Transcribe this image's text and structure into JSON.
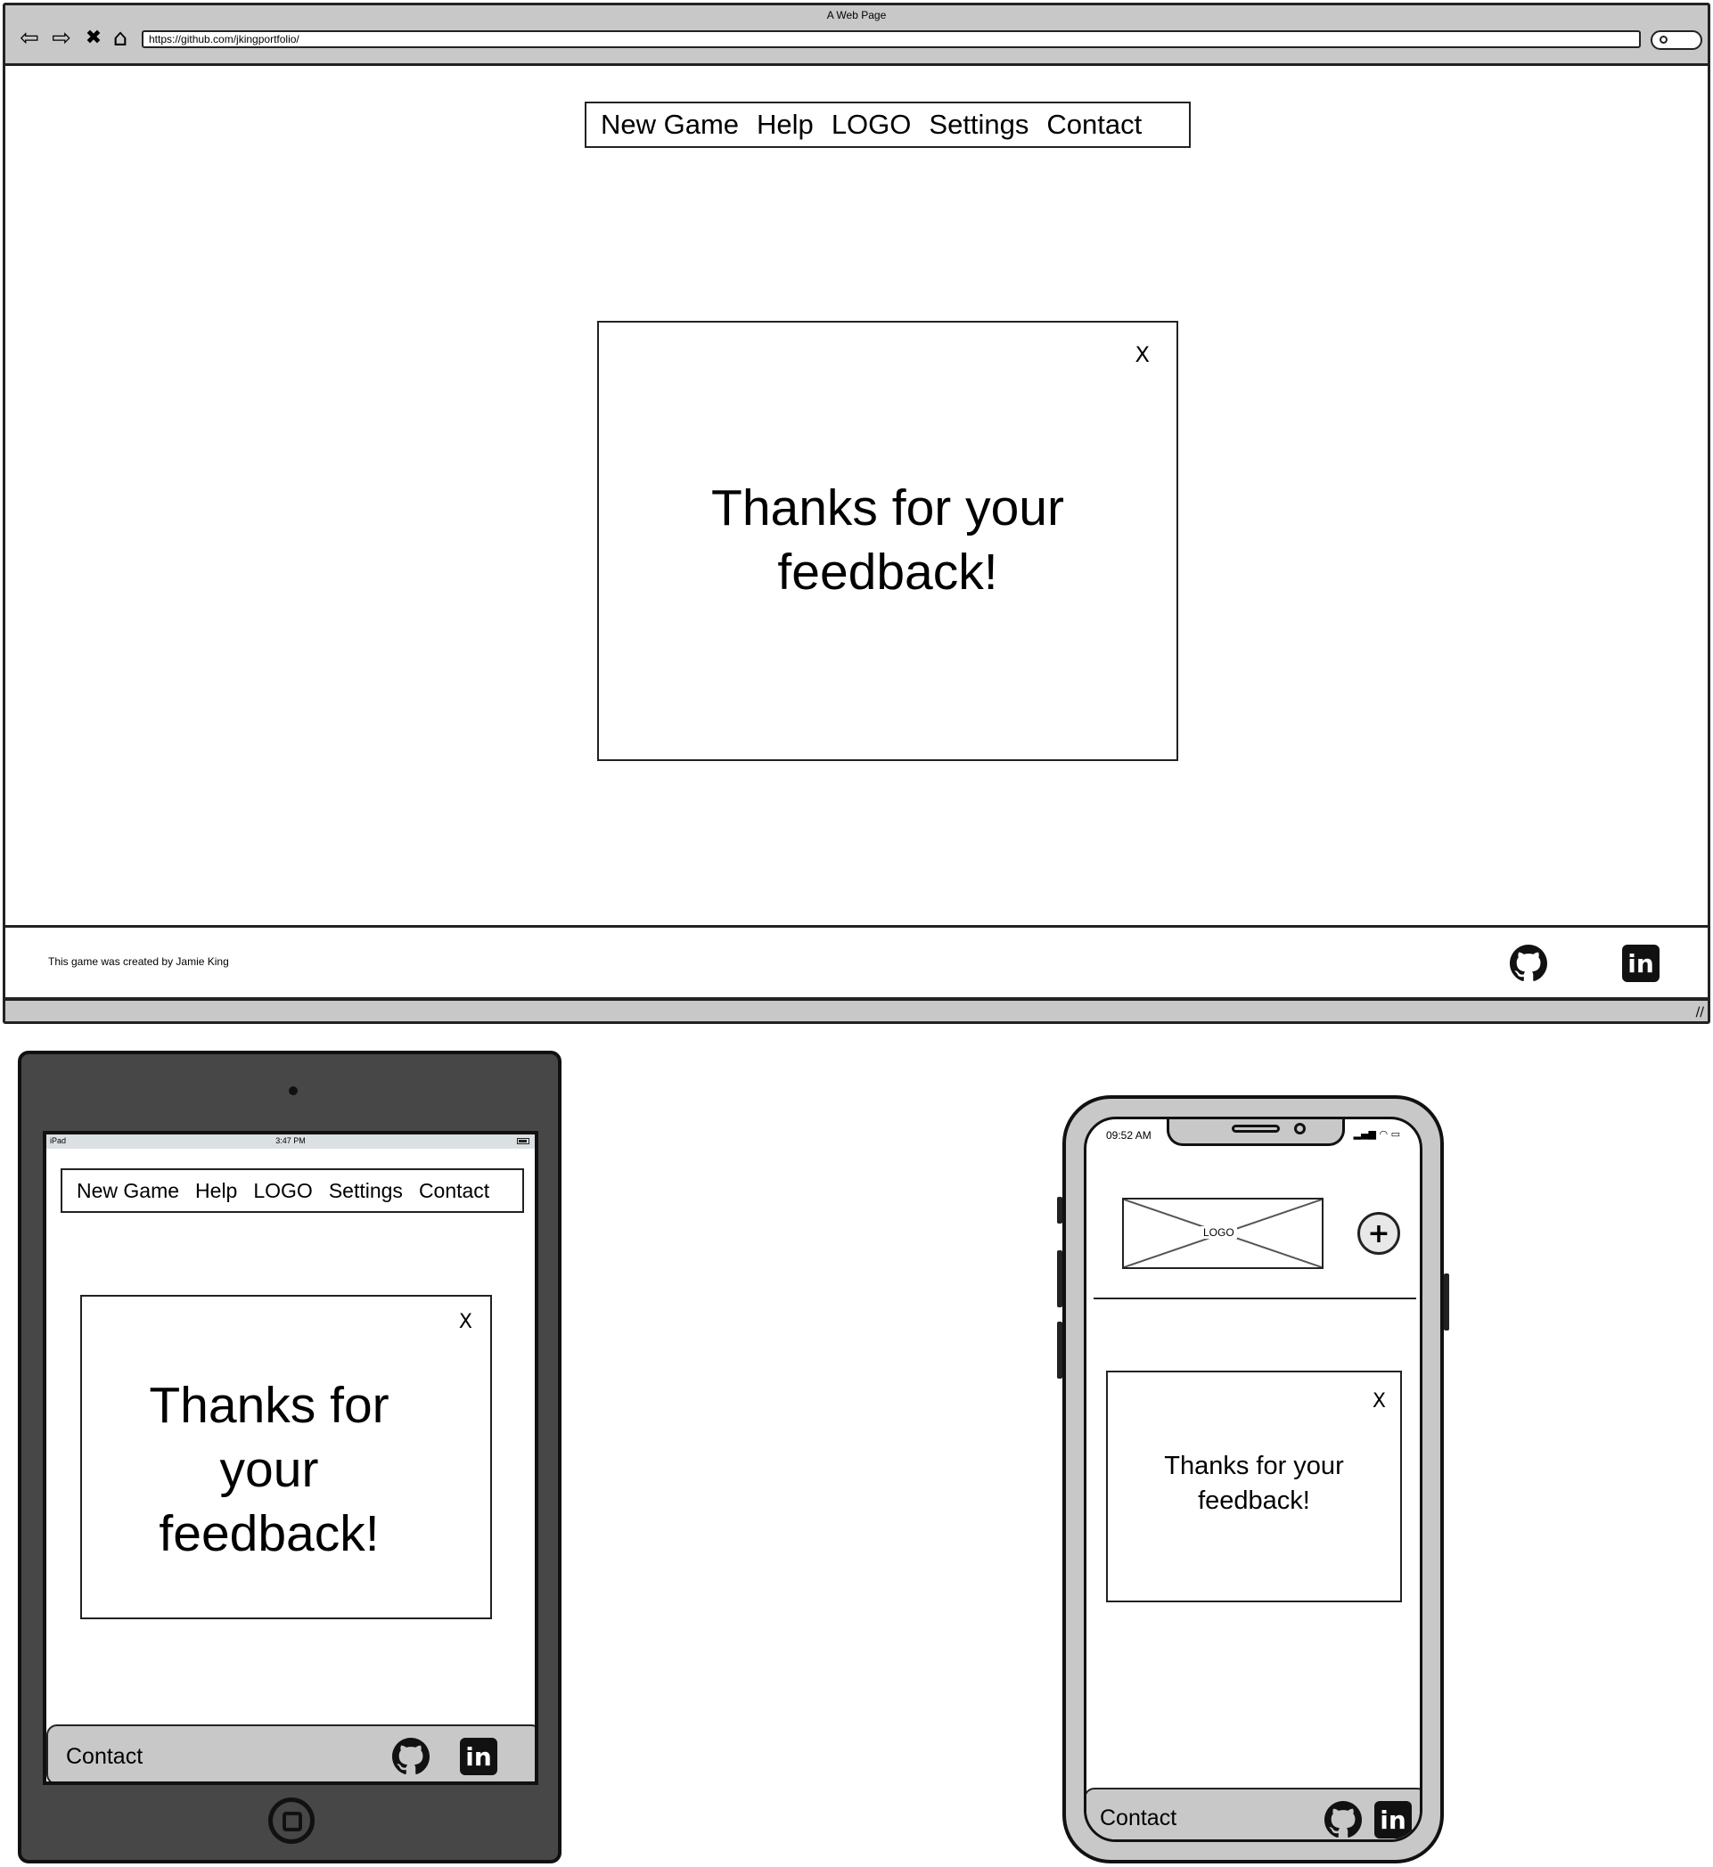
{
  "browser": {
    "title": "A Web Page",
    "url": "https://github.com/jkingportfolio/",
    "nav": {
      "back": "⇦",
      "forward": "⇨",
      "stop": "✖",
      "home": "⌂"
    }
  },
  "desktop": {
    "nav_items": [
      "New Game",
      "Help",
      "LOGO",
      "Settings",
      "Contact"
    ],
    "modal": {
      "close_label": "X",
      "message_line1": "Thanks for your",
      "message_line2": "feedback!"
    },
    "footer": {
      "credit": "This game was created by Jamie King"
    }
  },
  "tablet": {
    "status": {
      "device": "iPad",
      "time": "3:47 PM"
    },
    "nav_items": [
      "New Game",
      "Help",
      "LOGO",
      "Settings",
      "Contact"
    ],
    "modal": {
      "close_label": "X",
      "message_line1": "Thanks for",
      "message_line2": "your",
      "message_line3": "feedback!"
    },
    "footer": {
      "label": "Contact"
    }
  },
  "phone": {
    "status": {
      "time": "09:52 AM"
    },
    "logo_label": "LOGO",
    "menu_icon": "plus-icon",
    "modal": {
      "close_label": "X",
      "message_line1": "Thanks for your",
      "message_line2": "feedback!"
    },
    "footer": {
      "label": "Contact"
    }
  },
  "icons": {
    "github": "github-icon",
    "linkedin": "linkedin-icon",
    "linkedin_text": "in"
  }
}
